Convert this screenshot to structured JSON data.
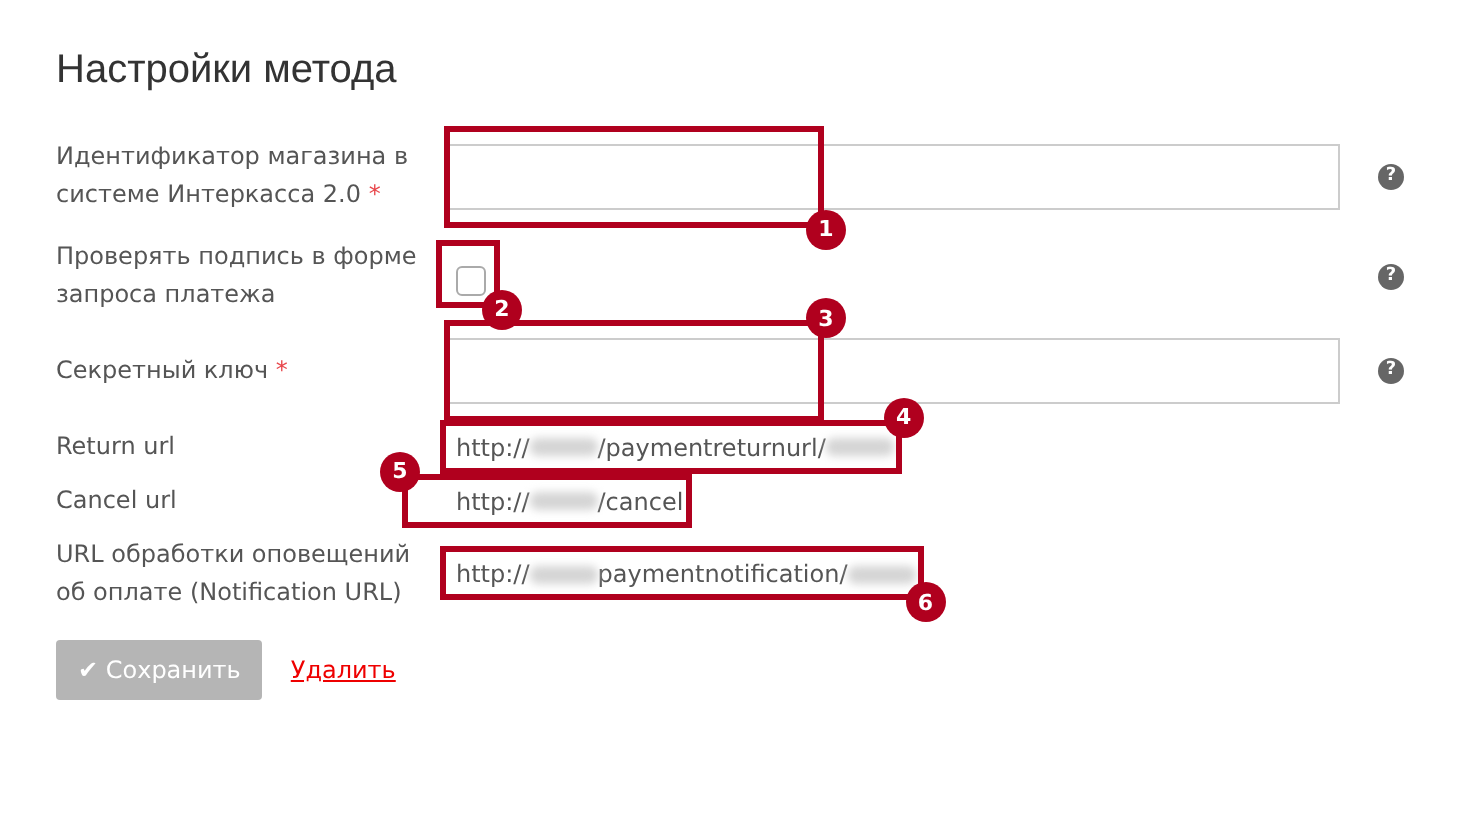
{
  "title": "Настройки метода",
  "fields": [
    {
      "kind": "input",
      "label": "Идентификатор магазина в системе Интеркасса 2.0",
      "required_mark": "*",
      "help": "?",
      "callout": "1"
    },
    {
      "kind": "checkbox",
      "label": "Проверять подпись в форме запроса платежа",
      "checked": false,
      "help": "?",
      "callout": "2"
    },
    {
      "kind": "input",
      "label": "Секретный ключ",
      "required_mark": "*",
      "help": "?",
      "callout": "3"
    },
    {
      "kind": "url",
      "label": "Return url",
      "parts": [
        {
          "kind": "text",
          "text": "http://"
        },
        {
          "kind": "blur"
        },
        {
          "kind": "text",
          "text": "/paymentreturnurl/"
        },
        {
          "kind": "blur"
        }
      ],
      "callout": "4"
    },
    {
      "kind": "url",
      "label": "Cancel url",
      "parts": [
        {
          "kind": "text",
          "text": "http://"
        },
        {
          "kind": "blur"
        },
        {
          "kind": "text",
          "text": "/cancel"
        }
      ],
      "callout": "5"
    },
    {
      "kind": "url",
      "label": "URL обработки оповещений об оплате (Notification URL)",
      "parts": [
        {
          "kind": "text",
          "text": "http://"
        },
        {
          "kind": "blur"
        },
        {
          "kind": "text",
          "text": "paymentnotification/"
        },
        {
          "kind": "blur"
        }
      ],
      "callout": "6"
    }
  ],
  "save_button": {
    "label": "✔ Сохранить",
    "disabled": true
  },
  "delete_link": "Удалить"
}
